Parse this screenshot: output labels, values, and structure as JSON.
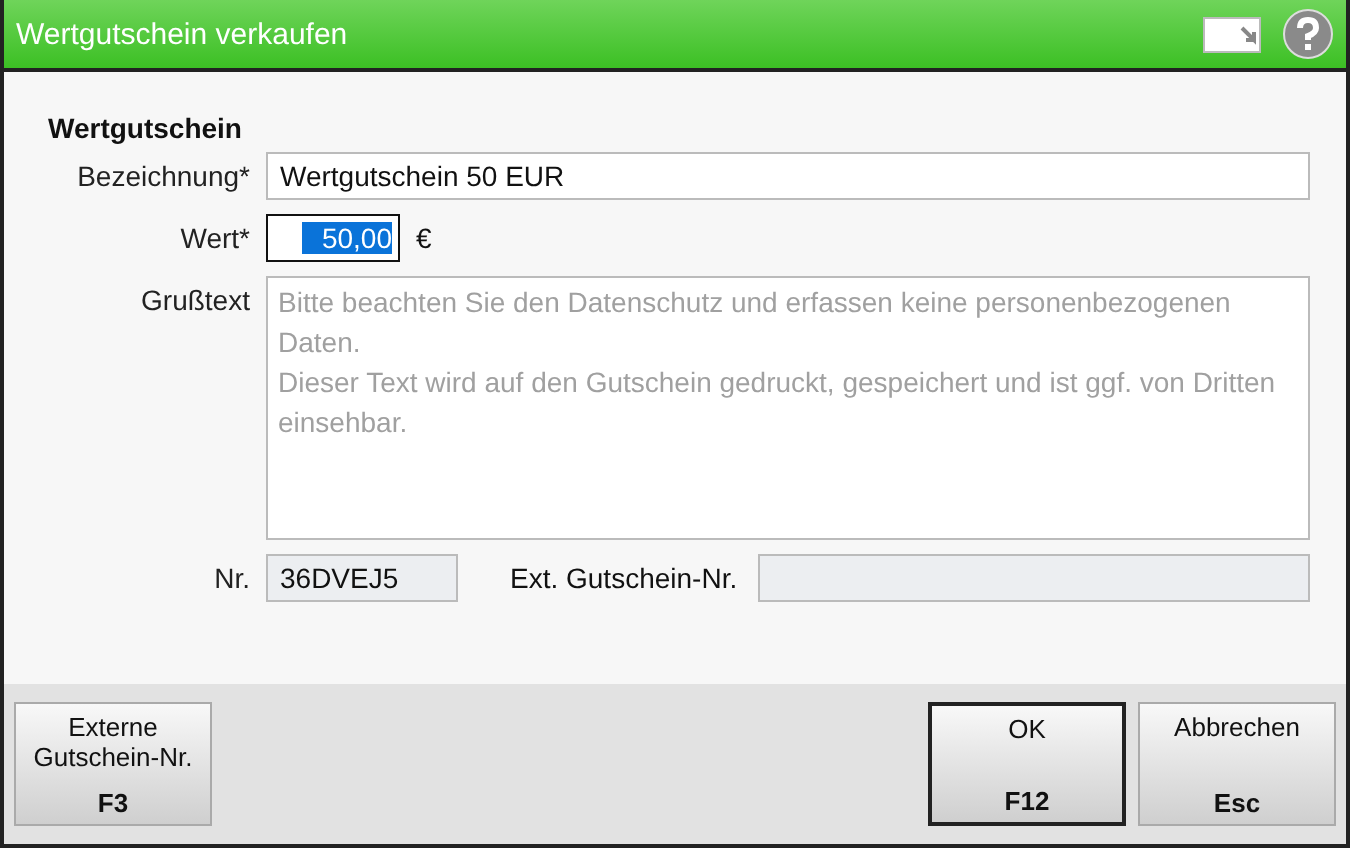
{
  "window": {
    "title": "Wertgutschein verkaufen"
  },
  "section": {
    "title": "Wertgutschein"
  },
  "fields": [
    {
      "kind": "text",
      "label": "Bezeichnung*",
      "value": "Wertgutschein 50 EUR"
    },
    {
      "kind": "amount",
      "label": "Wert*",
      "value": "50,00",
      "text_selected": true,
      "unit": "€"
    },
    {
      "kind": "textarea",
      "label": "Grußtext",
      "placeholder": "Bitte beachten Sie den Datenschutz und erfassen keine personenbezogenen Daten.\nDieser Text wird auf den Gutschein gedruckt, gespeichert und ist ggf. von Dritten einsehbar."
    }
  ],
  "number_row": {
    "label": "Nr.",
    "value": "36DVEJ5",
    "ext_label": "Ext. Gutschein-Nr."
  },
  "buttons": [
    {
      "label": "Externe Gutschein-Nr.",
      "key": "F3",
      "default": false
    },
    {
      "label": "OK",
      "key": "F12",
      "default": true
    },
    {
      "label": "Abbrechen",
      "key": "Esc",
      "default": false
    }
  ]
}
